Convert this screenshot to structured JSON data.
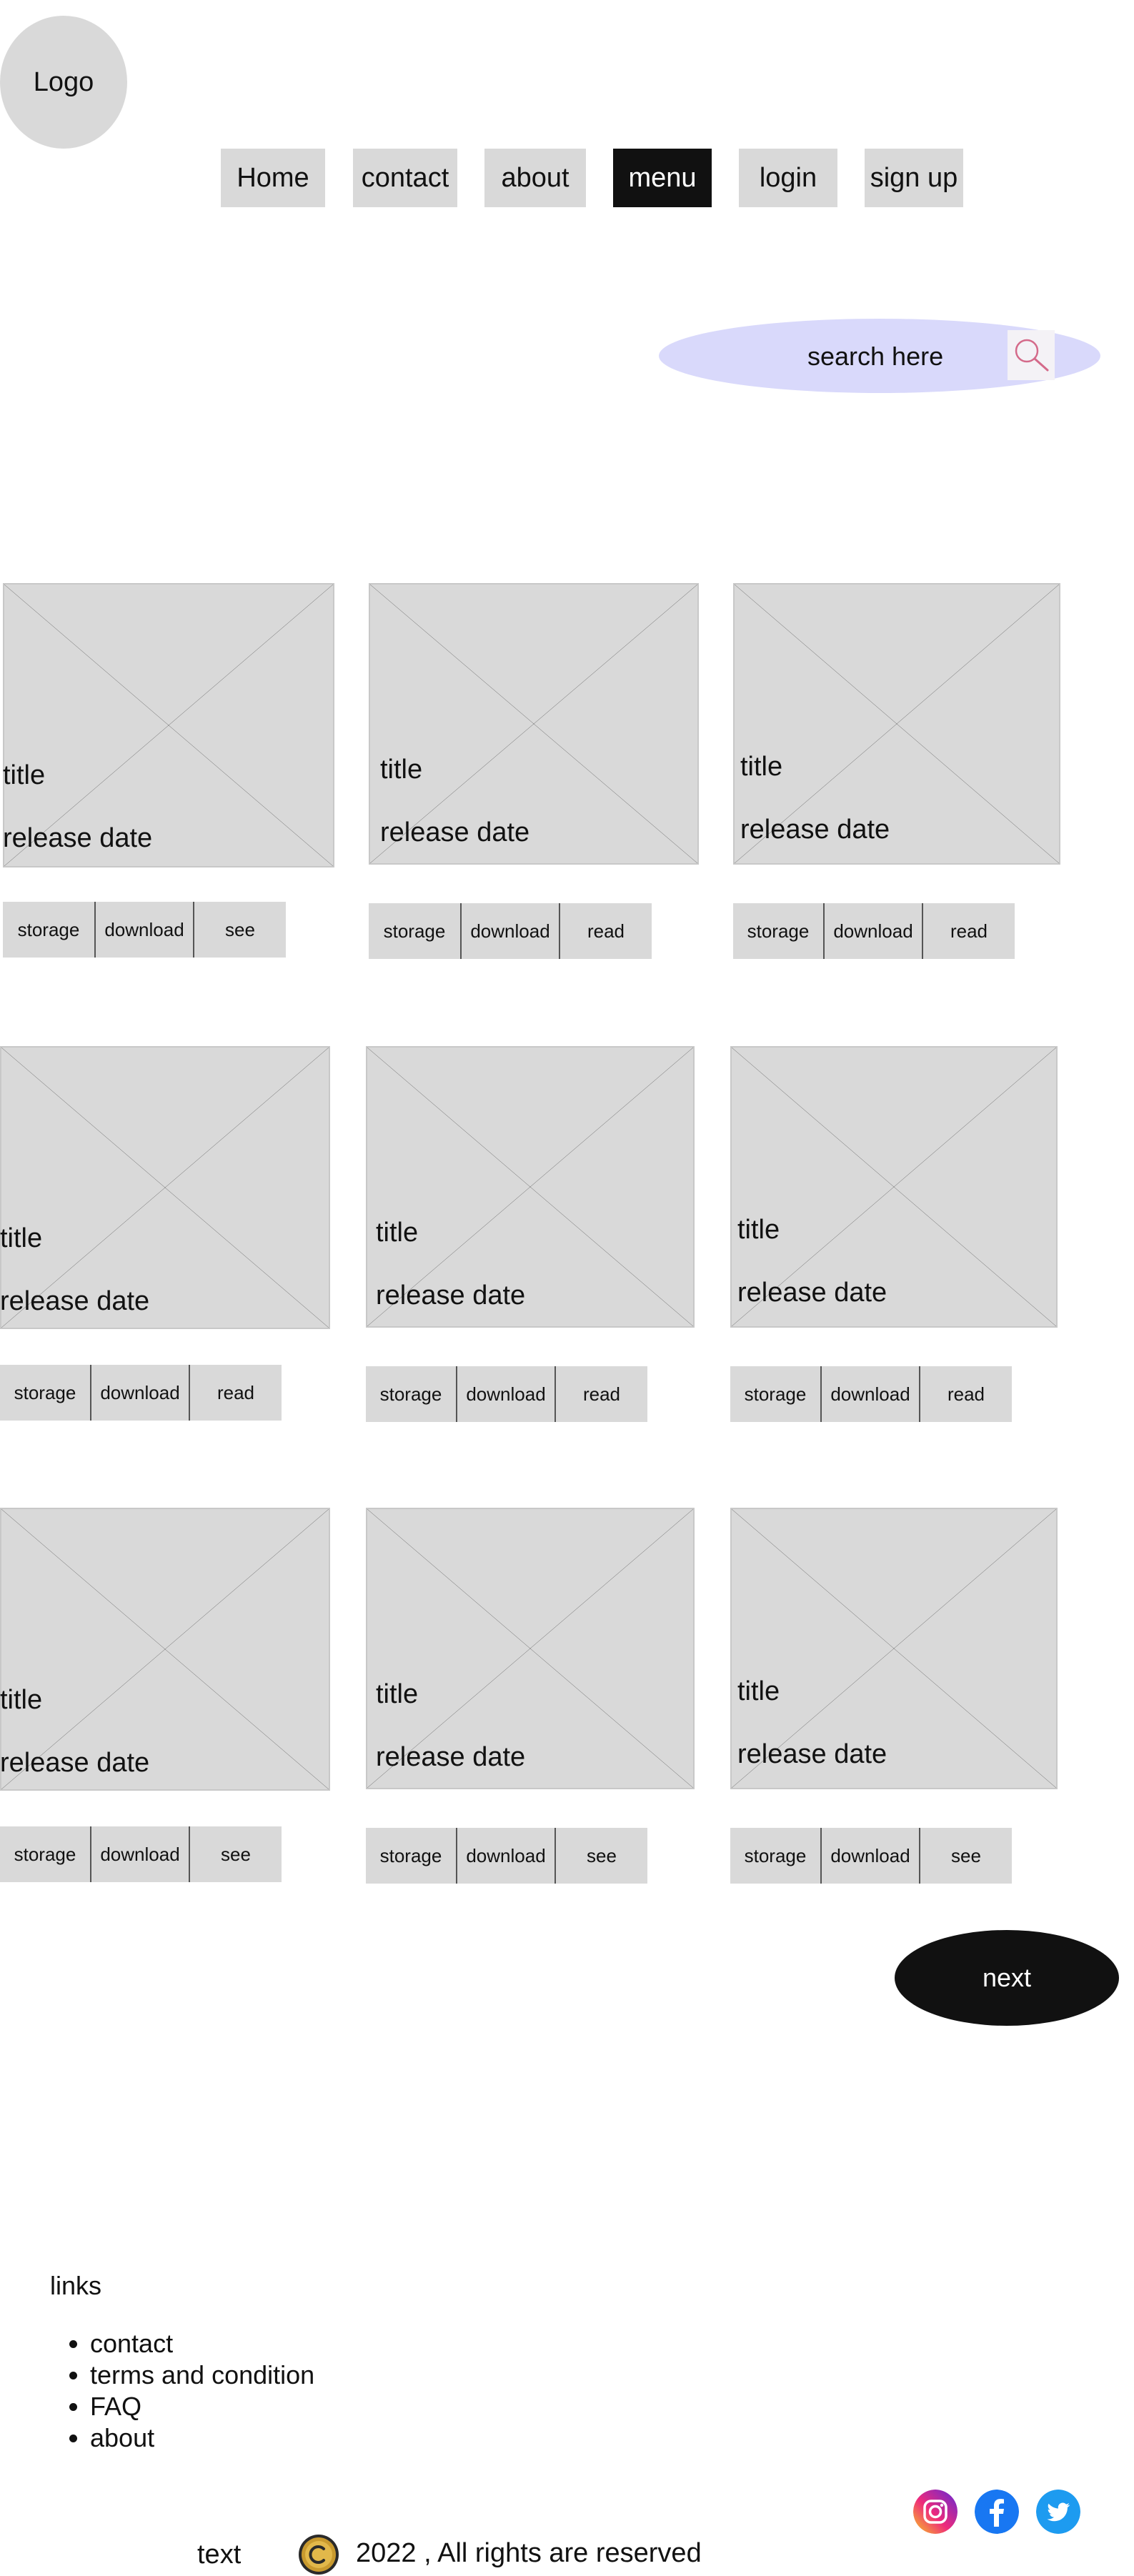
{
  "logo": {
    "label": "Logo"
  },
  "nav": {
    "items": [
      {
        "label": "Home"
      },
      {
        "label": "contact"
      },
      {
        "label": "about"
      },
      {
        "label": "menu",
        "active": true
      },
      {
        "label": "login"
      },
      {
        "label": "sign up"
      }
    ]
  },
  "search": {
    "placeholder": "search here",
    "icon": "magnifier-icon",
    "color": "#d9d9fb"
  },
  "cards": [
    {
      "title": "title",
      "release_date": "release date",
      "actions": [
        "storage",
        "download",
        "see"
      ]
    },
    {
      "title": "title",
      "release_date": "release date",
      "actions": [
        "storage",
        "download",
        "read"
      ]
    },
    {
      "title": "title",
      "release_date": "release date",
      "actions": [
        "storage",
        "download",
        "read"
      ]
    },
    {
      "title": "title",
      "release_date": "release date",
      "actions": [
        "storage",
        "download",
        "read"
      ]
    },
    {
      "title": "title",
      "release_date": "release date",
      "actions": [
        "storage",
        "download",
        "read"
      ]
    },
    {
      "title": "title",
      "release_date": "release date",
      "actions": [
        "storage",
        "download",
        "read"
      ]
    },
    {
      "title": "title",
      "release_date": "release date",
      "actions": [
        "storage",
        "download",
        "see"
      ]
    },
    {
      "title": "title",
      "release_date": "release date",
      "actions": [
        "storage",
        "download",
        "see"
      ]
    },
    {
      "title": "title",
      "release_date": "release date",
      "actions": [
        "storage",
        "download",
        "see"
      ]
    }
  ],
  "pagination": {
    "next_label": "next"
  },
  "footer": {
    "links_heading": "links",
    "links": [
      "contact",
      "terms and condition",
      "FAQ",
      "about"
    ],
    "text": "text",
    "copyright": "2022 , All rights are reserved",
    "social": [
      "instagram-icon",
      "facebook-icon",
      "twitter-icon"
    ]
  },
  "colors": {
    "placeholder_gray": "#d9d9d9",
    "dark": "#111111",
    "search_bg": "#d9d9fb"
  }
}
